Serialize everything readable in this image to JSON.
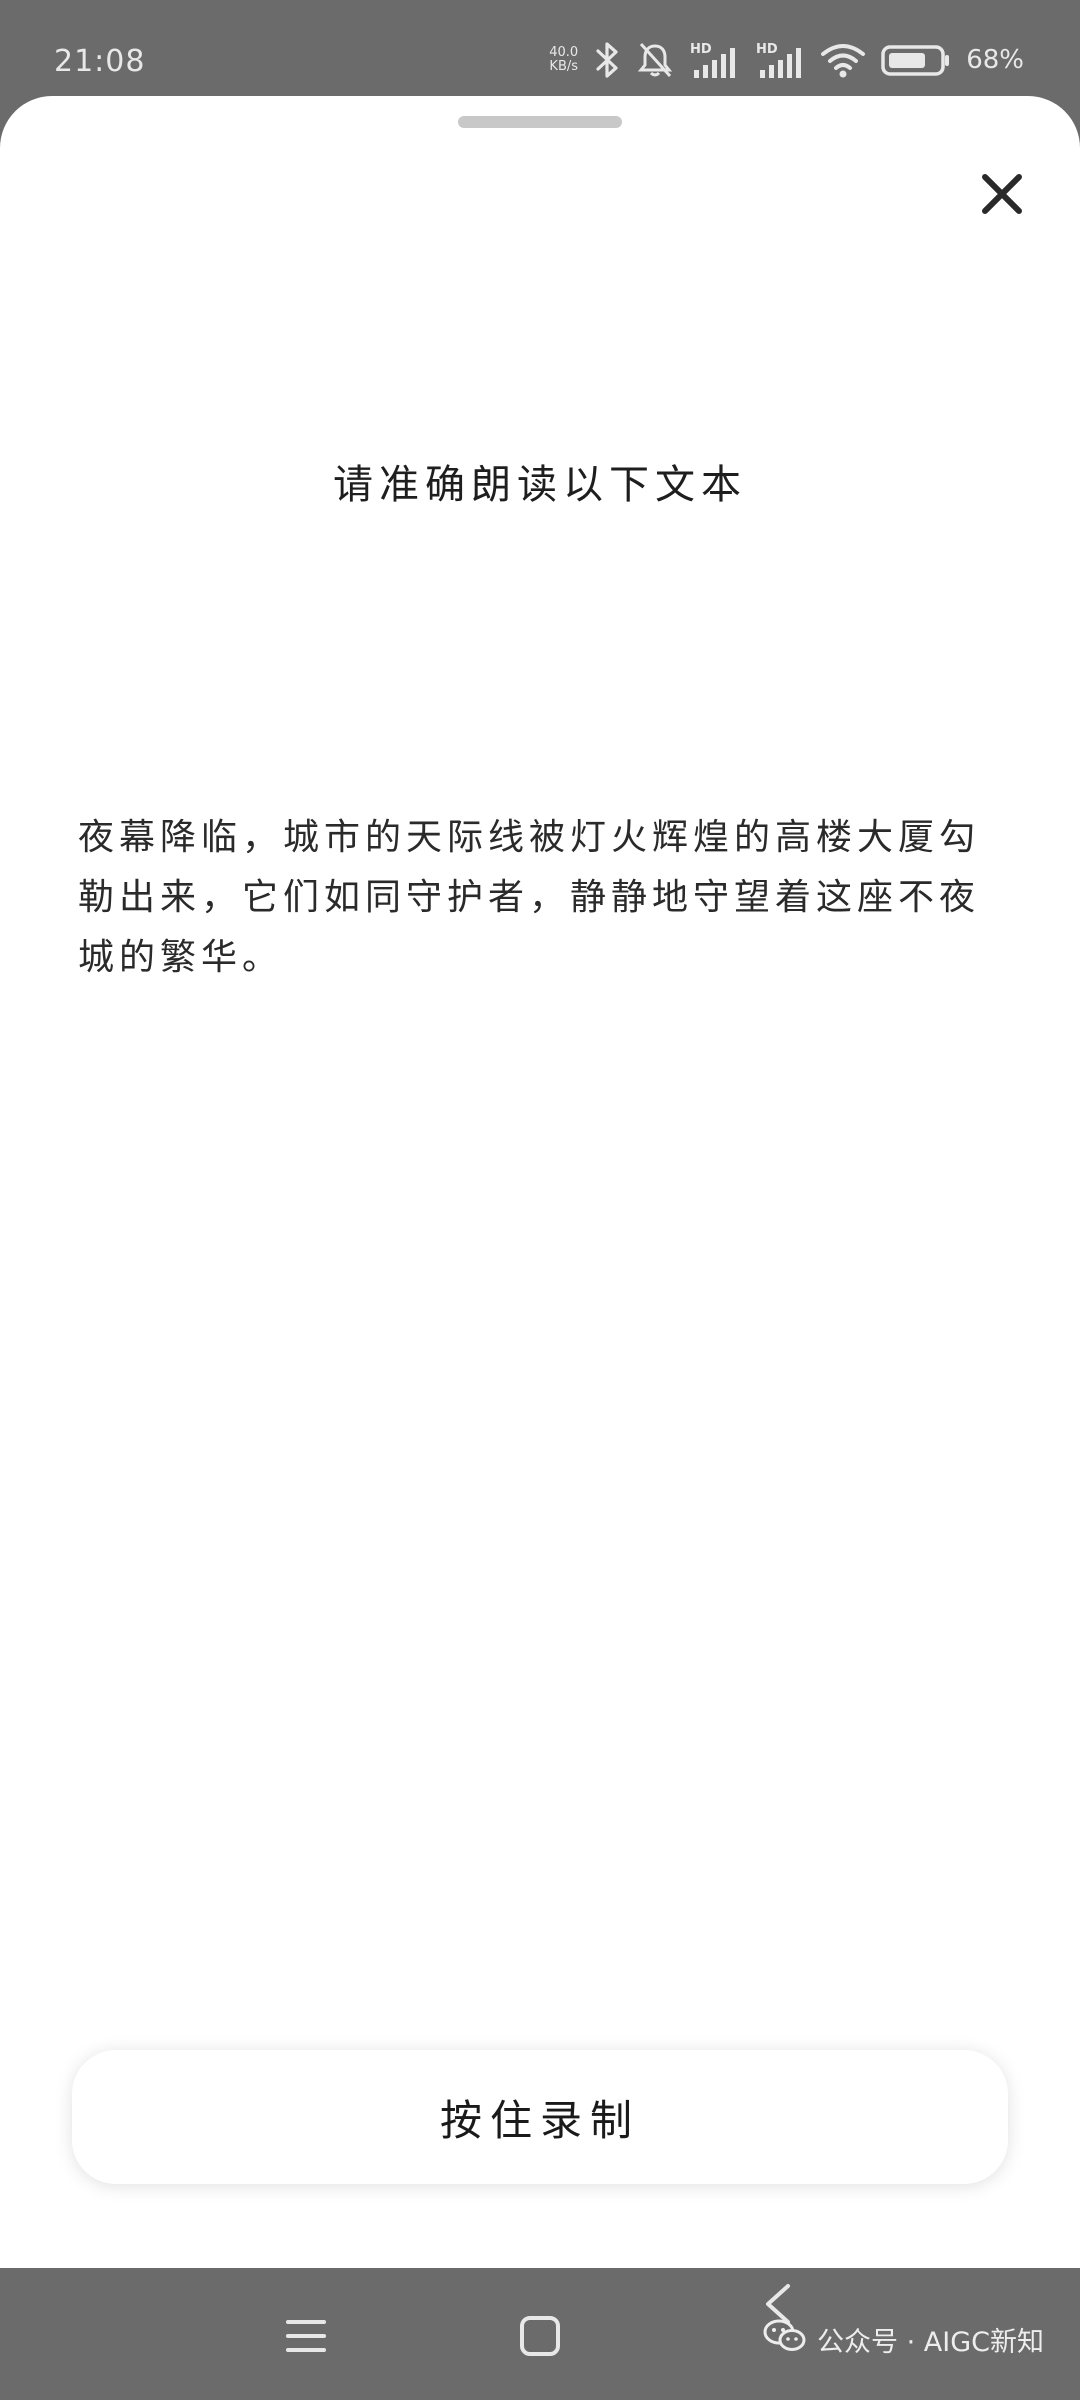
{
  "status_bar": {
    "time": "21:08",
    "net_speed_value": "40.0",
    "net_speed_unit": "KB/s",
    "hd1": "HD",
    "hd2": "HD",
    "battery_percent": "68%"
  },
  "sheet": {
    "title": "请准确朗读以下文本",
    "body_text": "夜幕降临，城市的天际线被灯火辉煌的高楼大厦勾勒出来，它们如同守护者，静静地守望着这座不夜城的繁华。",
    "record_button_label": "按住录制"
  },
  "watermark": {
    "text": "公众号 · AIGC新知"
  },
  "colors": {
    "system_bar_bg": "#6b6b6b",
    "sheet_bg": "#ffffff",
    "text_primary": "#1e1e1e"
  },
  "icons": [
    "bluetooth-icon",
    "bell-off-icon",
    "signal-icon",
    "wifi-icon",
    "battery-icon",
    "close-icon",
    "menu-icon",
    "home-icon",
    "back-icon",
    "wechat-icon"
  ]
}
